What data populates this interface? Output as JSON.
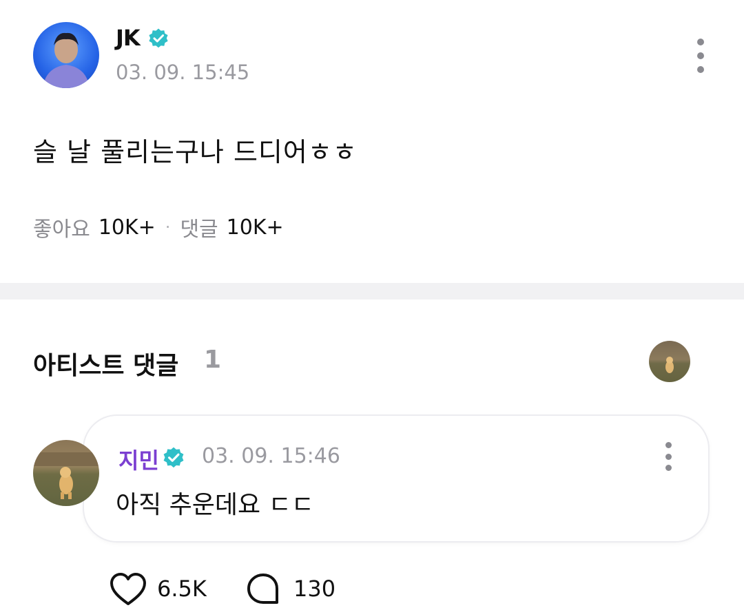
{
  "post": {
    "author": "JK",
    "time": "03. 09. 15:45",
    "body": "슬 날 풀리는구나 드디어ㅎㅎ",
    "likes_label": "좋아요",
    "likes_value": "10K+",
    "comments_label": "댓글",
    "comments_value": "10K+",
    "icons": {
      "verified": "verified-badge-icon",
      "more": "more-vertical-icon"
    }
  },
  "artist_comments": {
    "title": "아티스트 댓글",
    "count": "1"
  },
  "comment": {
    "author": "지민",
    "time": "03. 09. 15:46",
    "text": "아직 추운데요 ㄷㄷ",
    "likes": "6.5K",
    "replies": "130",
    "icons": {
      "like": "heart-icon",
      "reply": "speech-bubble-icon"
    }
  },
  "colors": {
    "verified": "#2fbfc8",
    "commenter_name": "#7b3fd1",
    "muted_text": "#9a9aa0",
    "divider": "#f1f1f3"
  }
}
